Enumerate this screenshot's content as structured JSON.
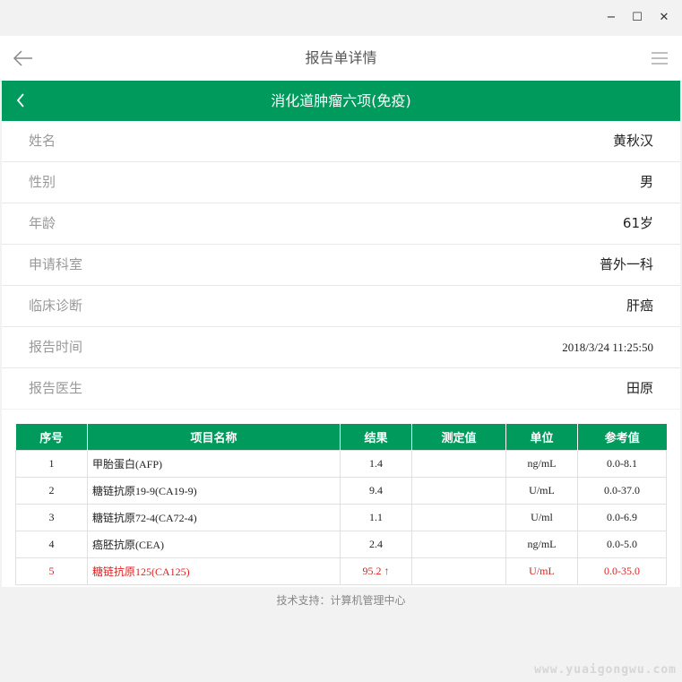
{
  "window": {
    "minimize": "−",
    "maximize": "☐",
    "close": "✕"
  },
  "appbar": {
    "title": "报告单详情",
    "back_icon": "arrow-left-icon",
    "menu_icon": "hamburger-menu-icon"
  },
  "report": {
    "title": "消化道肿瘤六项(免疫)",
    "back_icon": "chevron-left-icon"
  },
  "info": [
    {
      "label": "姓名",
      "value": "黄秋汉"
    },
    {
      "label": "性别",
      "value": "男"
    },
    {
      "label": "年龄",
      "value": "61岁"
    },
    {
      "label": "申请科室",
      "value": "普外一科"
    },
    {
      "label": "临床诊断",
      "value": "肝癌"
    },
    {
      "label": "报告时间",
      "value": "2018/3/24 11:25:50"
    },
    {
      "label": "报告医生",
      "value": "田原"
    }
  ],
  "table": {
    "headers": [
      "序号",
      "项目名称",
      "结果",
      "测定值",
      "单位",
      "参考值"
    ],
    "rows": [
      {
        "no": "1",
        "name": "甲胎蛋白(AFP)",
        "result": "1.4",
        "measured": "",
        "unit": "ng/mL",
        "ref": "0.0-8.1"
      },
      {
        "no": "2",
        "name": "糖链抗原19-9(CA19-9)",
        "result": "9.4",
        "measured": "",
        "unit": "U/mL",
        "ref": "0.0-37.0"
      },
      {
        "no": "3",
        "name": "糖链抗原72-4(CA72-4)",
        "result": "1.1",
        "measured": "",
        "unit": "U/ml",
        "ref": "0.0-6.9"
      },
      {
        "no": "4",
        "name": "癌胚抗原(CEA)",
        "result": "2.4",
        "measured": "",
        "unit": "ng/mL",
        "ref": "0.0-5.0"
      },
      {
        "no": "5",
        "name": "糖链抗原125(CA125)",
        "result": "95.2 ↑",
        "measured": "",
        "unit": "U/mL",
        "ref": "0.0-35.0"
      }
    ]
  },
  "colors": {
    "brand_green": "#009a5c",
    "abnormal_red": "#e02020"
  },
  "footer": {
    "text": "技术支持：计算机管理中心"
  },
  "watermark": "www.yuaigongwu.com"
}
